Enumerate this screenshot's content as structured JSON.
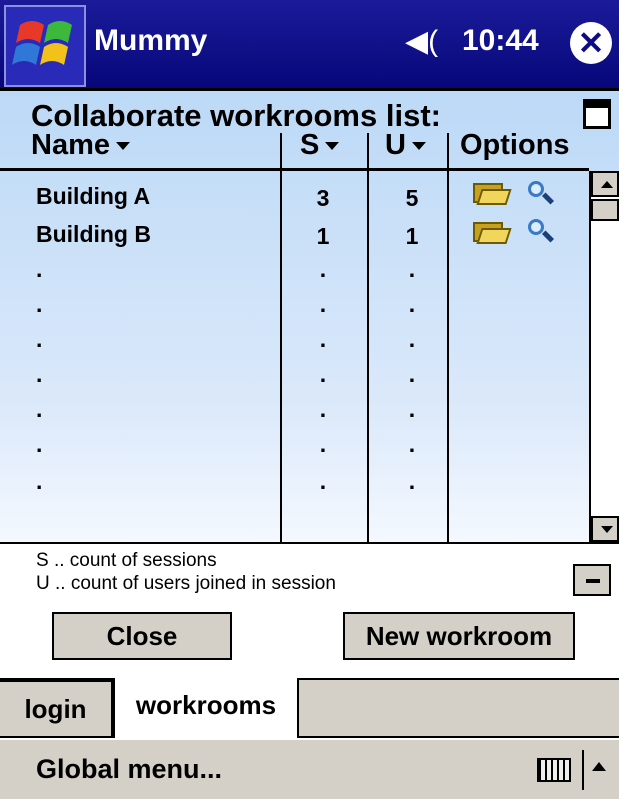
{
  "titlebar": {
    "app_name": "Mummy",
    "time": "10:44",
    "speaker_icon": "◀("
  },
  "list": {
    "heading": "Collaborate workrooms list:",
    "columns": {
      "name": "Name",
      "s": "S",
      "u": "U",
      "options": "Options"
    },
    "rows": [
      {
        "name": "Building A",
        "s": "3",
        "u": "5"
      },
      {
        "name": "Building B",
        "s": "1",
        "u": "1"
      },
      {
        "name": ".",
        "s": ".",
        "u": "."
      },
      {
        "name": ".",
        "s": ".",
        "u": "."
      },
      {
        "name": ".",
        "s": ".",
        "u": "."
      },
      {
        "name": ".",
        "s": ".",
        "u": "."
      },
      {
        "name": ".",
        "s": ".",
        "u": "."
      },
      {
        "name": ".",
        "s": ".",
        "u": "."
      },
      {
        "name": ".",
        "s": ".",
        "u": "."
      }
    ]
  },
  "legend": {
    "s": "S .. count of sessions",
    "u": "U .. count of users joined in session"
  },
  "buttons": {
    "close": "Close",
    "new_workroom": "New workroom"
  },
  "tabs": [
    {
      "label": "login"
    },
    {
      "label": "workrooms"
    }
  ],
  "menubar": {
    "global_menu": "Global menu..."
  },
  "icons": [
    "windows-logo-icon",
    "speaker-icon",
    "close-icon",
    "maximize-icon",
    "open-folder-icon",
    "magnifier-icon",
    "keyboard-icon",
    "chevron-up-icon"
  ]
}
